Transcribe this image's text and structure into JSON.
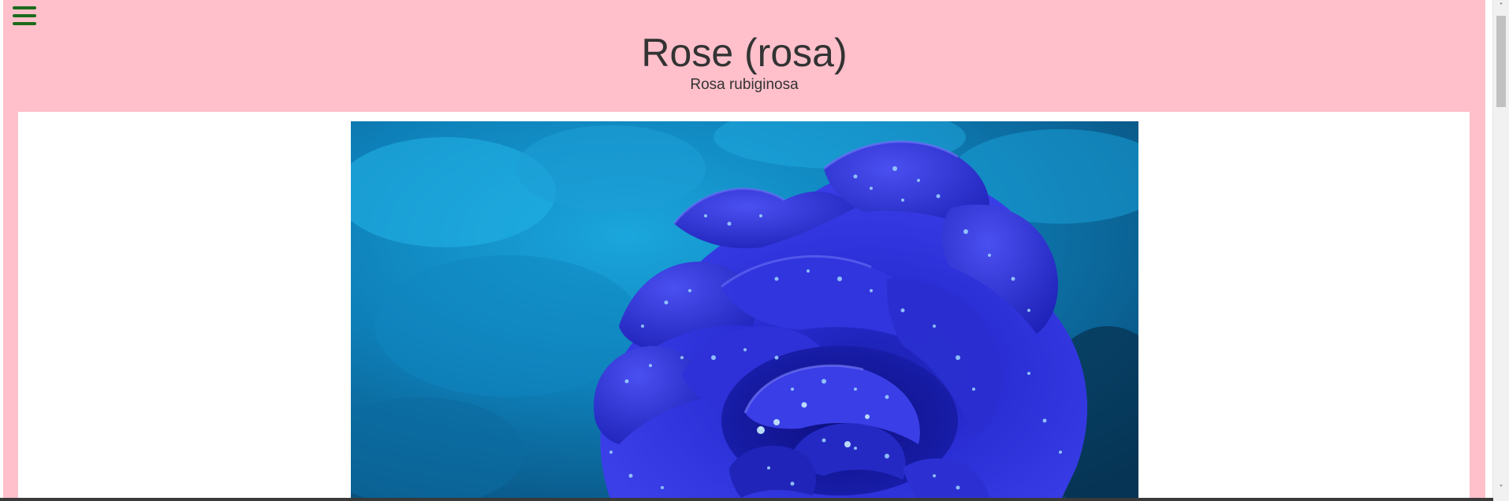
{
  "header": {
    "title": "Rose (rosa)",
    "subtitle": "Rosa rubiginosa"
  },
  "menu": {
    "icon": "hamburger-menu-icon",
    "color": "#1a6b1a"
  },
  "photo": {
    "subject": "blue rose with water droplets"
  },
  "colors": {
    "page_background": "#ffc0cb",
    "content_background": "#ffffff",
    "text": "#333333"
  },
  "scrollbar": {
    "up_arrow": "˄",
    "down_arrow": "˅"
  }
}
